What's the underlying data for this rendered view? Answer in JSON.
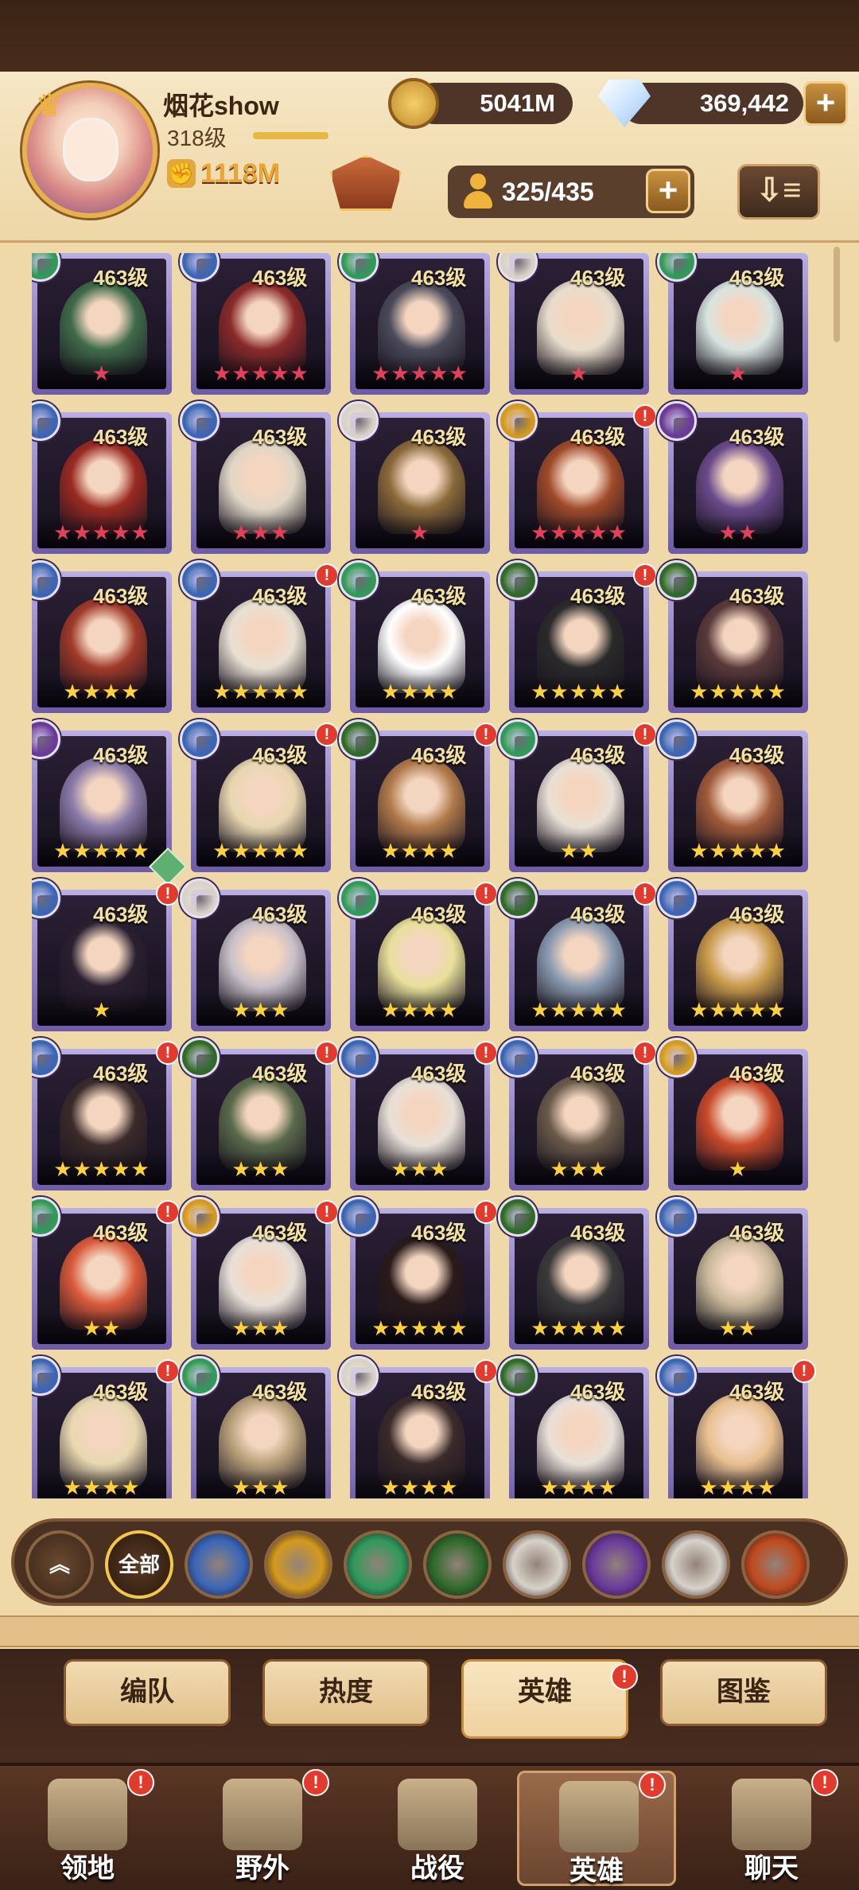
{
  "player": {
    "name": "烟花show",
    "level": "318级",
    "power": "1118M",
    "xp_fraction": 0.4
  },
  "resources": {
    "gold": "5041M",
    "gems": "369,442"
  },
  "hero_capacity": "325/435",
  "filters": {
    "all_label": "全部",
    "factions": [
      "lightbearer",
      "mauler",
      "wilder",
      "graveborn",
      "celestial",
      "hypogean",
      "dimensional"
    ]
  },
  "heroes": [
    {
      "level": "463级",
      "stars": "★",
      "star_color": "red",
      "faction": "wilder",
      "alert": ""
    },
    {
      "level": "463级",
      "stars": "★★★★★",
      "star_color": "red",
      "faction": "lightbearer",
      "alert": ""
    },
    {
      "level": "463级",
      "stars": "★★★★★",
      "star_color": "red",
      "faction": "wilder",
      "alert": ""
    },
    {
      "level": "463级",
      "stars": "★",
      "star_color": "red",
      "faction": "celestial",
      "alert": ""
    },
    {
      "level": "463级",
      "stars": "★",
      "star_color": "red",
      "faction": "wilder",
      "alert": ""
    },
    {
      "level": "463级",
      "stars": "★★★★★",
      "star_color": "red",
      "faction": "lightbearer",
      "alert": ""
    },
    {
      "level": "463级",
      "stars": "★★★",
      "star_color": "red",
      "faction": "lightbearer",
      "alert": ""
    },
    {
      "level": "463级",
      "stars": "★",
      "star_color": "red",
      "faction": "celestial",
      "alert": ""
    },
    {
      "level": "463级",
      "stars": "★★★★★",
      "star_color": "red",
      "faction": "mauler",
      "alert": "!"
    },
    {
      "level": "463级",
      "stars": "★★",
      "star_color": "red",
      "faction": "hypogean",
      "alert": ""
    },
    {
      "level": "463级",
      "stars": "★★★★",
      "star_color": "gold",
      "faction": "lightbearer",
      "alert": ""
    },
    {
      "level": "463级",
      "stars": "★★★★★",
      "star_color": "gold",
      "faction": "lightbearer",
      "alert": "!"
    },
    {
      "level": "463级",
      "stars": "★★★★",
      "star_color": "gold",
      "faction": "wilder",
      "alert": ""
    },
    {
      "level": "463级",
      "stars": "★★★★★",
      "star_color": "gold",
      "faction": "graveborn",
      "alert": "!"
    },
    {
      "level": "463级",
      "stars": "★★★★★",
      "star_color": "gold",
      "faction": "graveborn",
      "alert": ""
    },
    {
      "level": "463级",
      "stars": "★★★★★",
      "star_color": "gold",
      "faction": "hypogean",
      "alert": ""
    },
    {
      "level": "463级",
      "stars": "★★★★★",
      "star_color": "gold",
      "faction": "lightbearer",
      "alert": "!"
    },
    {
      "level": "463级",
      "stars": "★★★★",
      "star_color": "gold",
      "faction": "graveborn",
      "alert": "!"
    },
    {
      "level": "463级",
      "stars": "★★",
      "star_color": "gold",
      "faction": "wilder",
      "alert": "!"
    },
    {
      "level": "463级",
      "stars": "★★★★★",
      "star_color": "gold",
      "faction": "lightbearer",
      "alert": ""
    },
    {
      "level": "463级",
      "stars": "★",
      "star_color": "gold",
      "faction": "lightbearer",
      "alert": "!"
    },
    {
      "level": "463级",
      "stars": "★★★",
      "star_color": "gold",
      "faction": "celestial",
      "alert": ""
    },
    {
      "level": "463级",
      "stars": "★★★★",
      "star_color": "gold",
      "faction": "wilder",
      "alert": "!"
    },
    {
      "level": "463级",
      "stars": "★★★★★",
      "star_color": "gold",
      "faction": "graveborn",
      "alert": "!"
    },
    {
      "level": "463级",
      "stars": "★★★★★",
      "star_color": "gold",
      "faction": "lightbearer",
      "alert": ""
    },
    {
      "level": "463级",
      "stars": "★★★★★",
      "star_color": "gold",
      "faction": "lightbearer",
      "alert": "!"
    },
    {
      "level": "463级",
      "stars": "★★★",
      "star_color": "gold",
      "faction": "graveborn",
      "alert": "!"
    },
    {
      "level": "463级",
      "stars": "★★★",
      "star_color": "gold",
      "faction": "lightbearer",
      "alert": "!"
    },
    {
      "level": "463级",
      "stars": "★★★",
      "star_color": "gold",
      "faction": "lightbearer",
      "alert": "!"
    },
    {
      "level": "463级",
      "stars": "★",
      "star_color": "gold",
      "faction": "mauler",
      "alert": ""
    },
    {
      "level": "463级",
      "stars": "★★",
      "star_color": "gold",
      "faction": "wilder",
      "alert": "!"
    },
    {
      "level": "463级",
      "stars": "★★★",
      "star_color": "gold",
      "faction": "mauler",
      "alert": "!"
    },
    {
      "level": "463级",
      "stars": "★★★★★",
      "star_color": "gold",
      "faction": "lightbearer",
      "alert": "!"
    },
    {
      "level": "463级",
      "stars": "★★★★★",
      "star_color": "gold",
      "faction": "graveborn",
      "alert": ""
    },
    {
      "level": "463级",
      "stars": "★★",
      "star_color": "gold",
      "faction": "lightbearer",
      "alert": ""
    },
    {
      "level": "463级",
      "stars": "★★★★",
      "star_color": "gold",
      "faction": "lightbearer",
      "alert": "!"
    },
    {
      "level": "463级",
      "stars": "★★★",
      "star_color": "gold",
      "faction": "wilder",
      "alert": ""
    },
    {
      "level": "463级",
      "stars": "★★★★",
      "star_color": "gold",
      "faction": "celestial",
      "alert": "!"
    },
    {
      "level": "463级",
      "stars": "★★★★",
      "star_color": "gold",
      "faction": "graveborn",
      "alert": ""
    },
    {
      "level": "463级",
      "stars": "★★★★",
      "star_color": "gold",
      "faction": "lightbearer",
      "alert": "!"
    }
  ],
  "sub_tabs": [
    "编队",
    "热度",
    "英雄",
    "图鉴"
  ],
  "active_sub_tab": "英雄",
  "nav": [
    {
      "label": "领地",
      "alert": "!"
    },
    {
      "label": "野外",
      "alert": "!"
    },
    {
      "label": "战役",
      "alert": ""
    },
    {
      "label": "英雄",
      "alert": "!"
    },
    {
      "label": "聊天",
      "alert": "!"
    }
  ],
  "active_nav": "英雄",
  "faction_colors": {
    "lightbearer": "#3a66b8",
    "mauler": "#d49a1e",
    "wilder": "#2f9a5a",
    "graveborn": "#2f6a2a",
    "celestial": "#d8d2c8",
    "hypogean": "#6a3a9a",
    "dimensional": "#c04a1e"
  }
}
